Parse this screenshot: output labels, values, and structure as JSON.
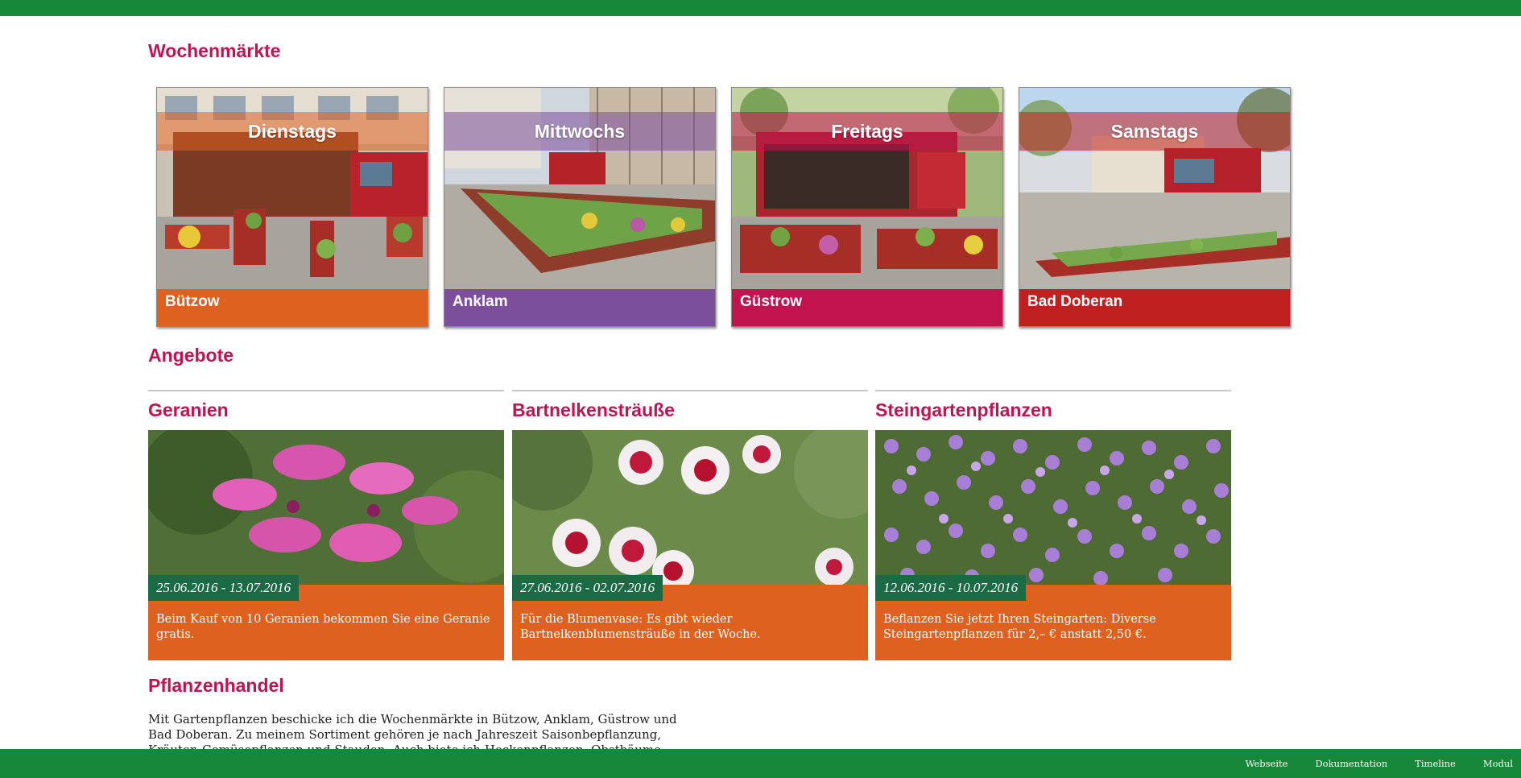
{
  "colors": {
    "brand_green": "#17873a",
    "accent_crimson": "#c2134e",
    "orange": "#de6120",
    "purple": "#7b4f9b",
    "red": "#c0201f",
    "date_green": "#1a6a45"
  },
  "sections": {
    "markets_title": "Wochenmärkte",
    "offers_title": "Angebote",
    "trade_title": "Pflanzenhandel"
  },
  "markets": [
    {
      "day": "Dienstags",
      "place": "Bützow",
      "color": "#de6120"
    },
    {
      "day": "Mittwochs",
      "place": "Anklam",
      "color": "#7b4f9b"
    },
    {
      "day": "Freitags",
      "place": "Güstrow",
      "color": "#c2134e"
    },
    {
      "day": "Samstags",
      "place": "Bad Doberan",
      "color": "#c0201f"
    }
  ],
  "offers": [
    {
      "title": "Geranien",
      "date": "25.06.2016 - 13.07.2016",
      "text": "Beim Kauf von 10 Geranien bekommen Sie eine Geranie gratis."
    },
    {
      "title": "Bartnelkensträuße",
      "date": "27.06.2016 - 02.07.2016",
      "text": "Für die Blumenvase: Es gibt wieder Bartnelkenblumensträuße in der Woche."
    },
    {
      "title": "Steingartenpflanzen",
      "date": "12.06.2016 - 10.07.2016",
      "text": "Beflanzen Sie jetzt Ihren Steingarten: Diverse Steingartenpflanzen für 2,– € anstatt 2,50 €."
    }
  ],
  "intro_text": "Mit Gartenpflanzen beschicke ich die Wochenmärkte in Bützow, Anklam, Güstrow und Bad Doberan. Zu meinem Sortiment gehören je nach Jahreszeit Saisonbepflanzung, Kräuter, Gemüsepflanzen und Stauden. Auch biete ich Heckenpflanzen, Obstbäume",
  "footer": {
    "links": [
      "Webseite",
      "Dokumentation",
      "Timeline",
      "Modul"
    ]
  }
}
